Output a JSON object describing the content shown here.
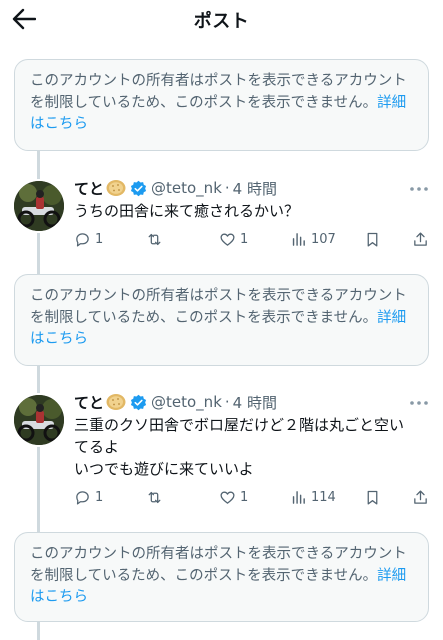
{
  "header": {
    "title": "ポスト"
  },
  "restricted": {
    "text": "このアカウントの所有者はポストを表示できるアカウントを制限しているため、このポストを表示できません。",
    "learn_more": "詳細はこちら"
  },
  "posts": [
    {
      "display_name": "てと",
      "handle": "@teto_nk",
      "separator": "·",
      "time": "4 時間",
      "lines": [
        "うちの田舎に来て癒されるかい？"
      ],
      "replies": "1",
      "reposts": "",
      "likes": "1",
      "views": "107"
    },
    {
      "display_name": "てと",
      "handle": "@teto_nk",
      "separator": "·",
      "time": "4 時間",
      "lines": [
        "三重のクソ田舎でボロ屋だけど２階は丸ごと空い",
        "てるよ",
        "いつでも遊びに来ていいよ"
      ],
      "replies": "1",
      "reposts": "",
      "likes": "1",
      "views": "114"
    }
  ],
  "colors": {
    "accent": "#1d9bf0",
    "secondary_text": "#536471",
    "border": "#cfd9de",
    "box_bg": "#f7f9f9"
  },
  "icons": [
    "back-arrow-icon",
    "rice-cracker-emoji-icon",
    "verified-badge-icon",
    "more-icon",
    "reply-icon",
    "repost-icon",
    "like-icon",
    "views-icon",
    "bookmark-icon",
    "share-icon"
  ]
}
